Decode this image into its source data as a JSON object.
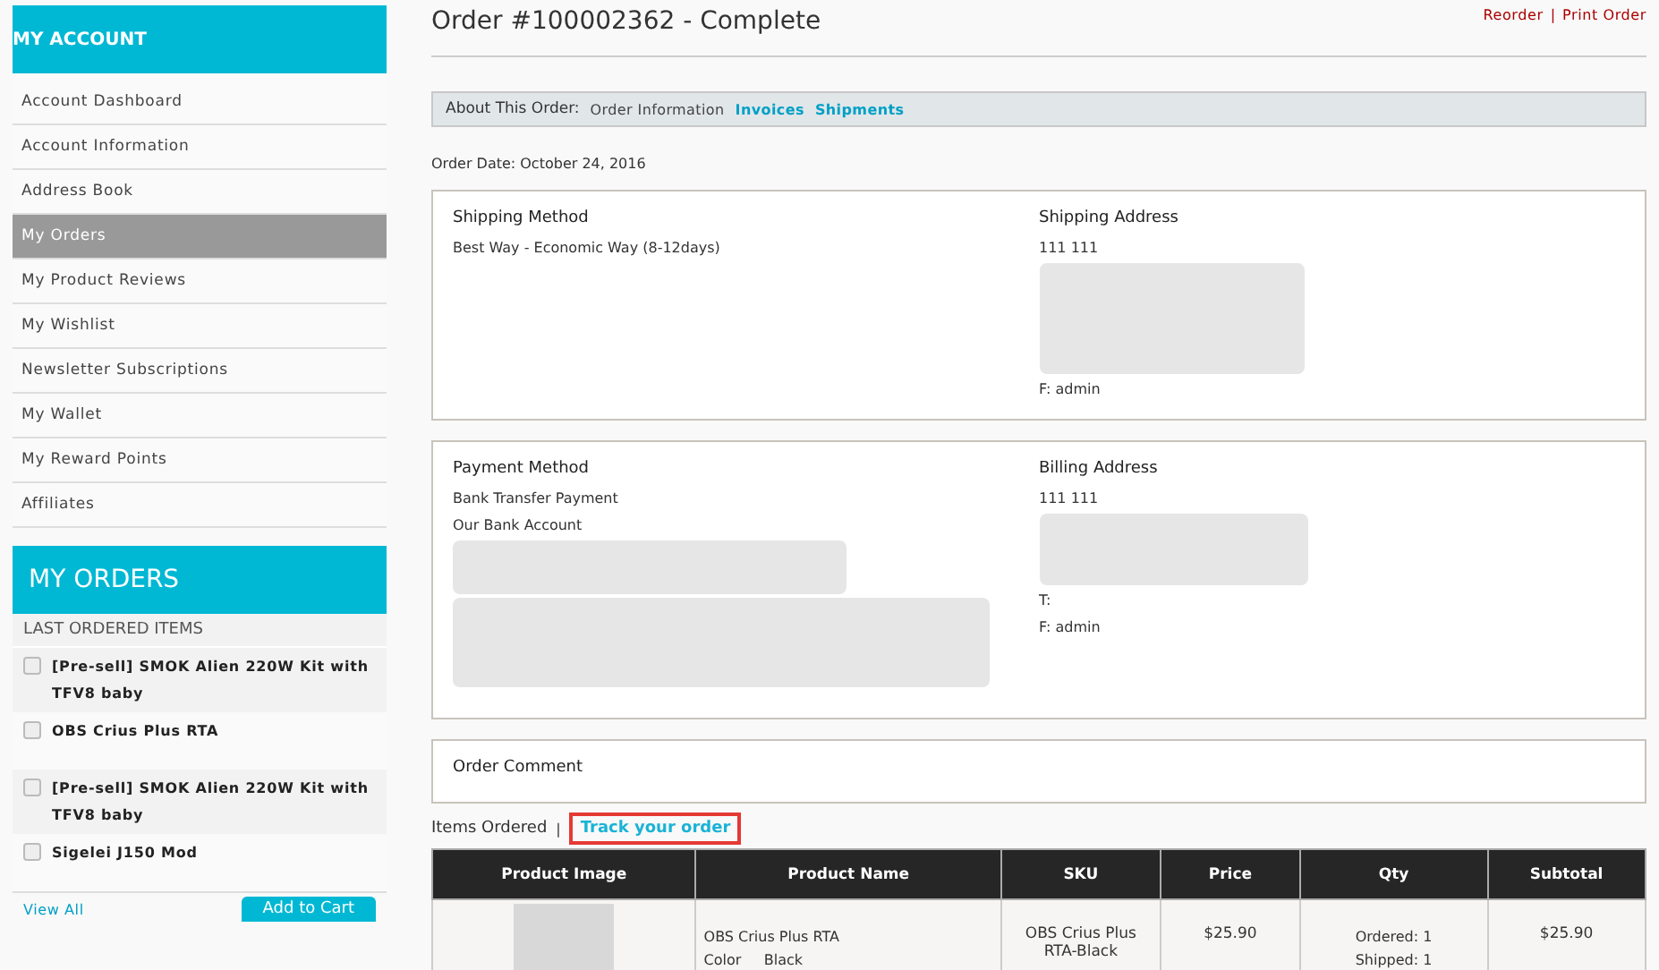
{
  "sidebar": {
    "title": "MY ACCOUNT",
    "items": [
      {
        "label": "Account Dashboard",
        "selected": false
      },
      {
        "label": "Account Information",
        "selected": false
      },
      {
        "label": "Address Book",
        "selected": false
      },
      {
        "label": "My Orders",
        "selected": true
      },
      {
        "label": "My Product Reviews",
        "selected": false
      },
      {
        "label": "My Wishlist",
        "selected": false
      },
      {
        "label": "Newsletter Subscriptions",
        "selected": false
      },
      {
        "label": "My Wallet",
        "selected": false
      },
      {
        "label": "My Reward Points",
        "selected": false
      },
      {
        "label": "Affiliates",
        "selected": false
      }
    ]
  },
  "my_orders": {
    "title": "MY ORDERS",
    "subtitle": "LAST ORDERED ITEMS",
    "items": [
      {
        "name": "[Pre-sell] SMOK Alien 220W Kit with TFV8 baby",
        "checked": false
      },
      {
        "name": "OBS Crius Plus RTA",
        "checked": false
      },
      {
        "name": "[Pre-sell] SMOK Alien 220W Kit with TFV8 baby",
        "checked": false
      },
      {
        "name": "Sigelei J150 Mod",
        "checked": false
      }
    ],
    "view_all": "View All",
    "add_to_cart": "Add to Cart"
  },
  "order": {
    "title": "Order #100002362 - Complete",
    "actions": [
      "Reorder",
      "Print Order"
    ],
    "actions_separator": "|",
    "about_label": "About This Order:",
    "about_tabs": [
      {
        "label": "Order Information",
        "selected": true
      },
      {
        "label": "Invoices",
        "selected": false
      },
      {
        "label": "Shipments",
        "selected": false
      }
    ],
    "date": "Order Date: October 24, 2016",
    "shipping_method": {
      "title": "Shipping Method",
      "lines": [
        "Best Way - Economic Way (8-12days)"
      ]
    },
    "shipping_address": {
      "title": "Shipping Address",
      "lines": [
        "111 111",
        "F: admin"
      ]
    },
    "payment_method": {
      "title": "Payment Method",
      "lines": [
        "Bank Transfer Payment",
        "Our Bank Account"
      ]
    },
    "billing_address": {
      "title": "Billing Address",
      "lines": [
        "111 111",
        "T:",
        "F: admin"
      ]
    },
    "comment_title": "Order Comment",
    "items_label": "Items Ordered",
    "items_separator": "|",
    "track_link": "Track your order",
    "table": {
      "columns": [
        "Product Image",
        "Product Name",
        "SKU",
        "Price",
        "Qty",
        "Subtotal"
      ],
      "rows": [
        {
          "name": "OBS Crius Plus RTA",
          "option_label": "Color",
          "option_value": "Black",
          "sku": "OBS Crius Plus RTA-Black",
          "price": "$25.90",
          "qty": [
            "Ordered: 1",
            "Shipped: 1"
          ],
          "subtotal": "$25.90"
        }
      ]
    }
  }
}
